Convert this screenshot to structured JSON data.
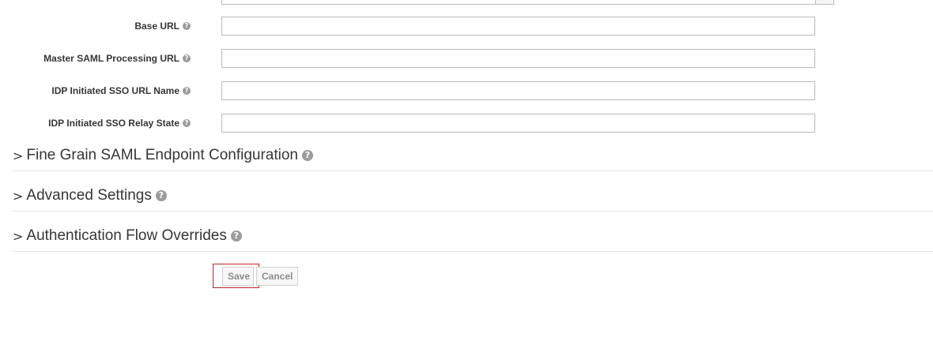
{
  "form": {
    "fields": [
      {
        "label": "Base URL",
        "value": ""
      },
      {
        "label": "Master SAML Processing URL",
        "value": ""
      },
      {
        "label": "IDP Initiated SSO URL Name",
        "value": ""
      },
      {
        "label": "IDP Initiated SSO Relay State",
        "value": ""
      }
    ],
    "help_glyph": "?"
  },
  "sections": [
    {
      "title": "Fine Grain SAML Endpoint Configuration",
      "expander": ">"
    },
    {
      "title": "Advanced Settings",
      "expander": ">"
    },
    {
      "title": "Authentication Flow Overrides",
      "expander": ">"
    }
  ],
  "actions": {
    "save_label": "Save",
    "cancel_label": "Cancel"
  },
  "colors": {
    "focus_outline": "#c0262d",
    "help_icon": "#9c9c9c"
  }
}
